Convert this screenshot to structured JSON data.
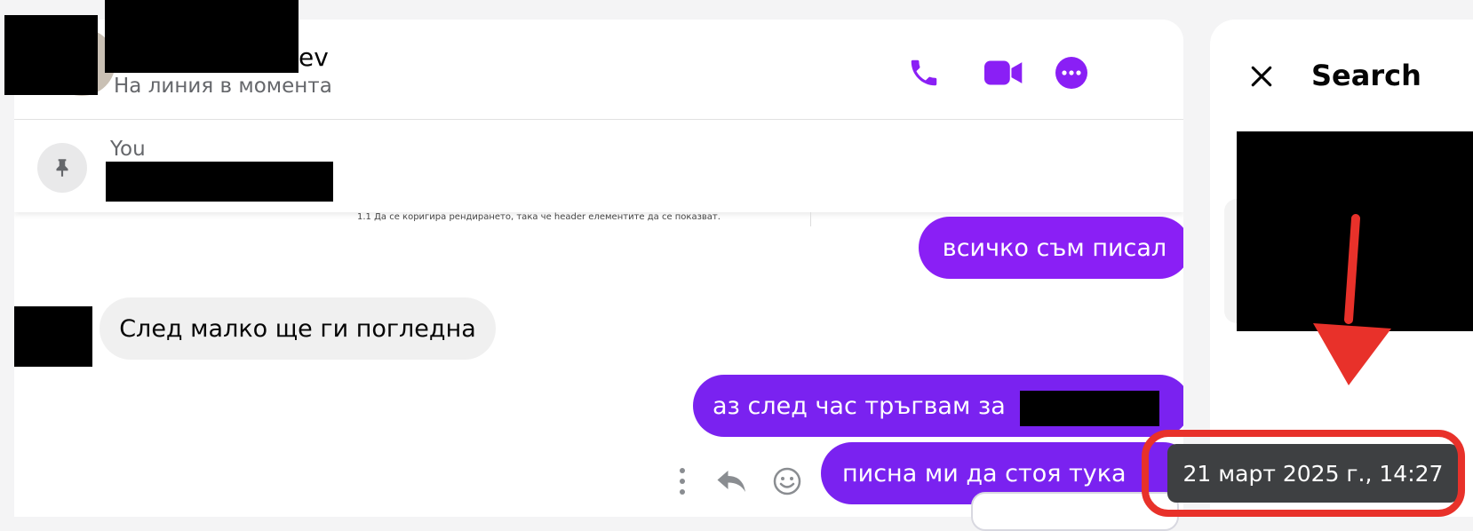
{
  "header": {
    "contact_name_visible": "ev",
    "status": "На линия в момента",
    "call_icon": "phone-icon",
    "video_icon": "video-camera-icon",
    "more_icon": "more-options-icon"
  },
  "pinned": {
    "author": "You",
    "pin_icon": "pushpin-icon",
    "peek_text": "1.1 Да се коригира рендирането, така че header елементите да се показват."
  },
  "messages": [
    {
      "direction": "outgoing",
      "text": "всичко съм писал"
    },
    {
      "direction": "incoming",
      "text": "След малко ще ги погледна"
    },
    {
      "direction": "outgoing",
      "text": "аз след час тръгвам за"
    },
    {
      "direction": "outgoing",
      "text": "писна ми да стоя тука"
    }
  ],
  "message_actions": [
    "more-vertical-icon",
    "reply-icon",
    "emoji-react-icon"
  ],
  "search_panel": {
    "title": "Search",
    "close_icon": "close-icon"
  },
  "tooltip": {
    "timestamp": "21 март 2025 г., 14:27"
  },
  "colors": {
    "accent": "#8a1ff5",
    "annotation_red": "#e8312a",
    "tooltip_bg": "#3e4042"
  }
}
